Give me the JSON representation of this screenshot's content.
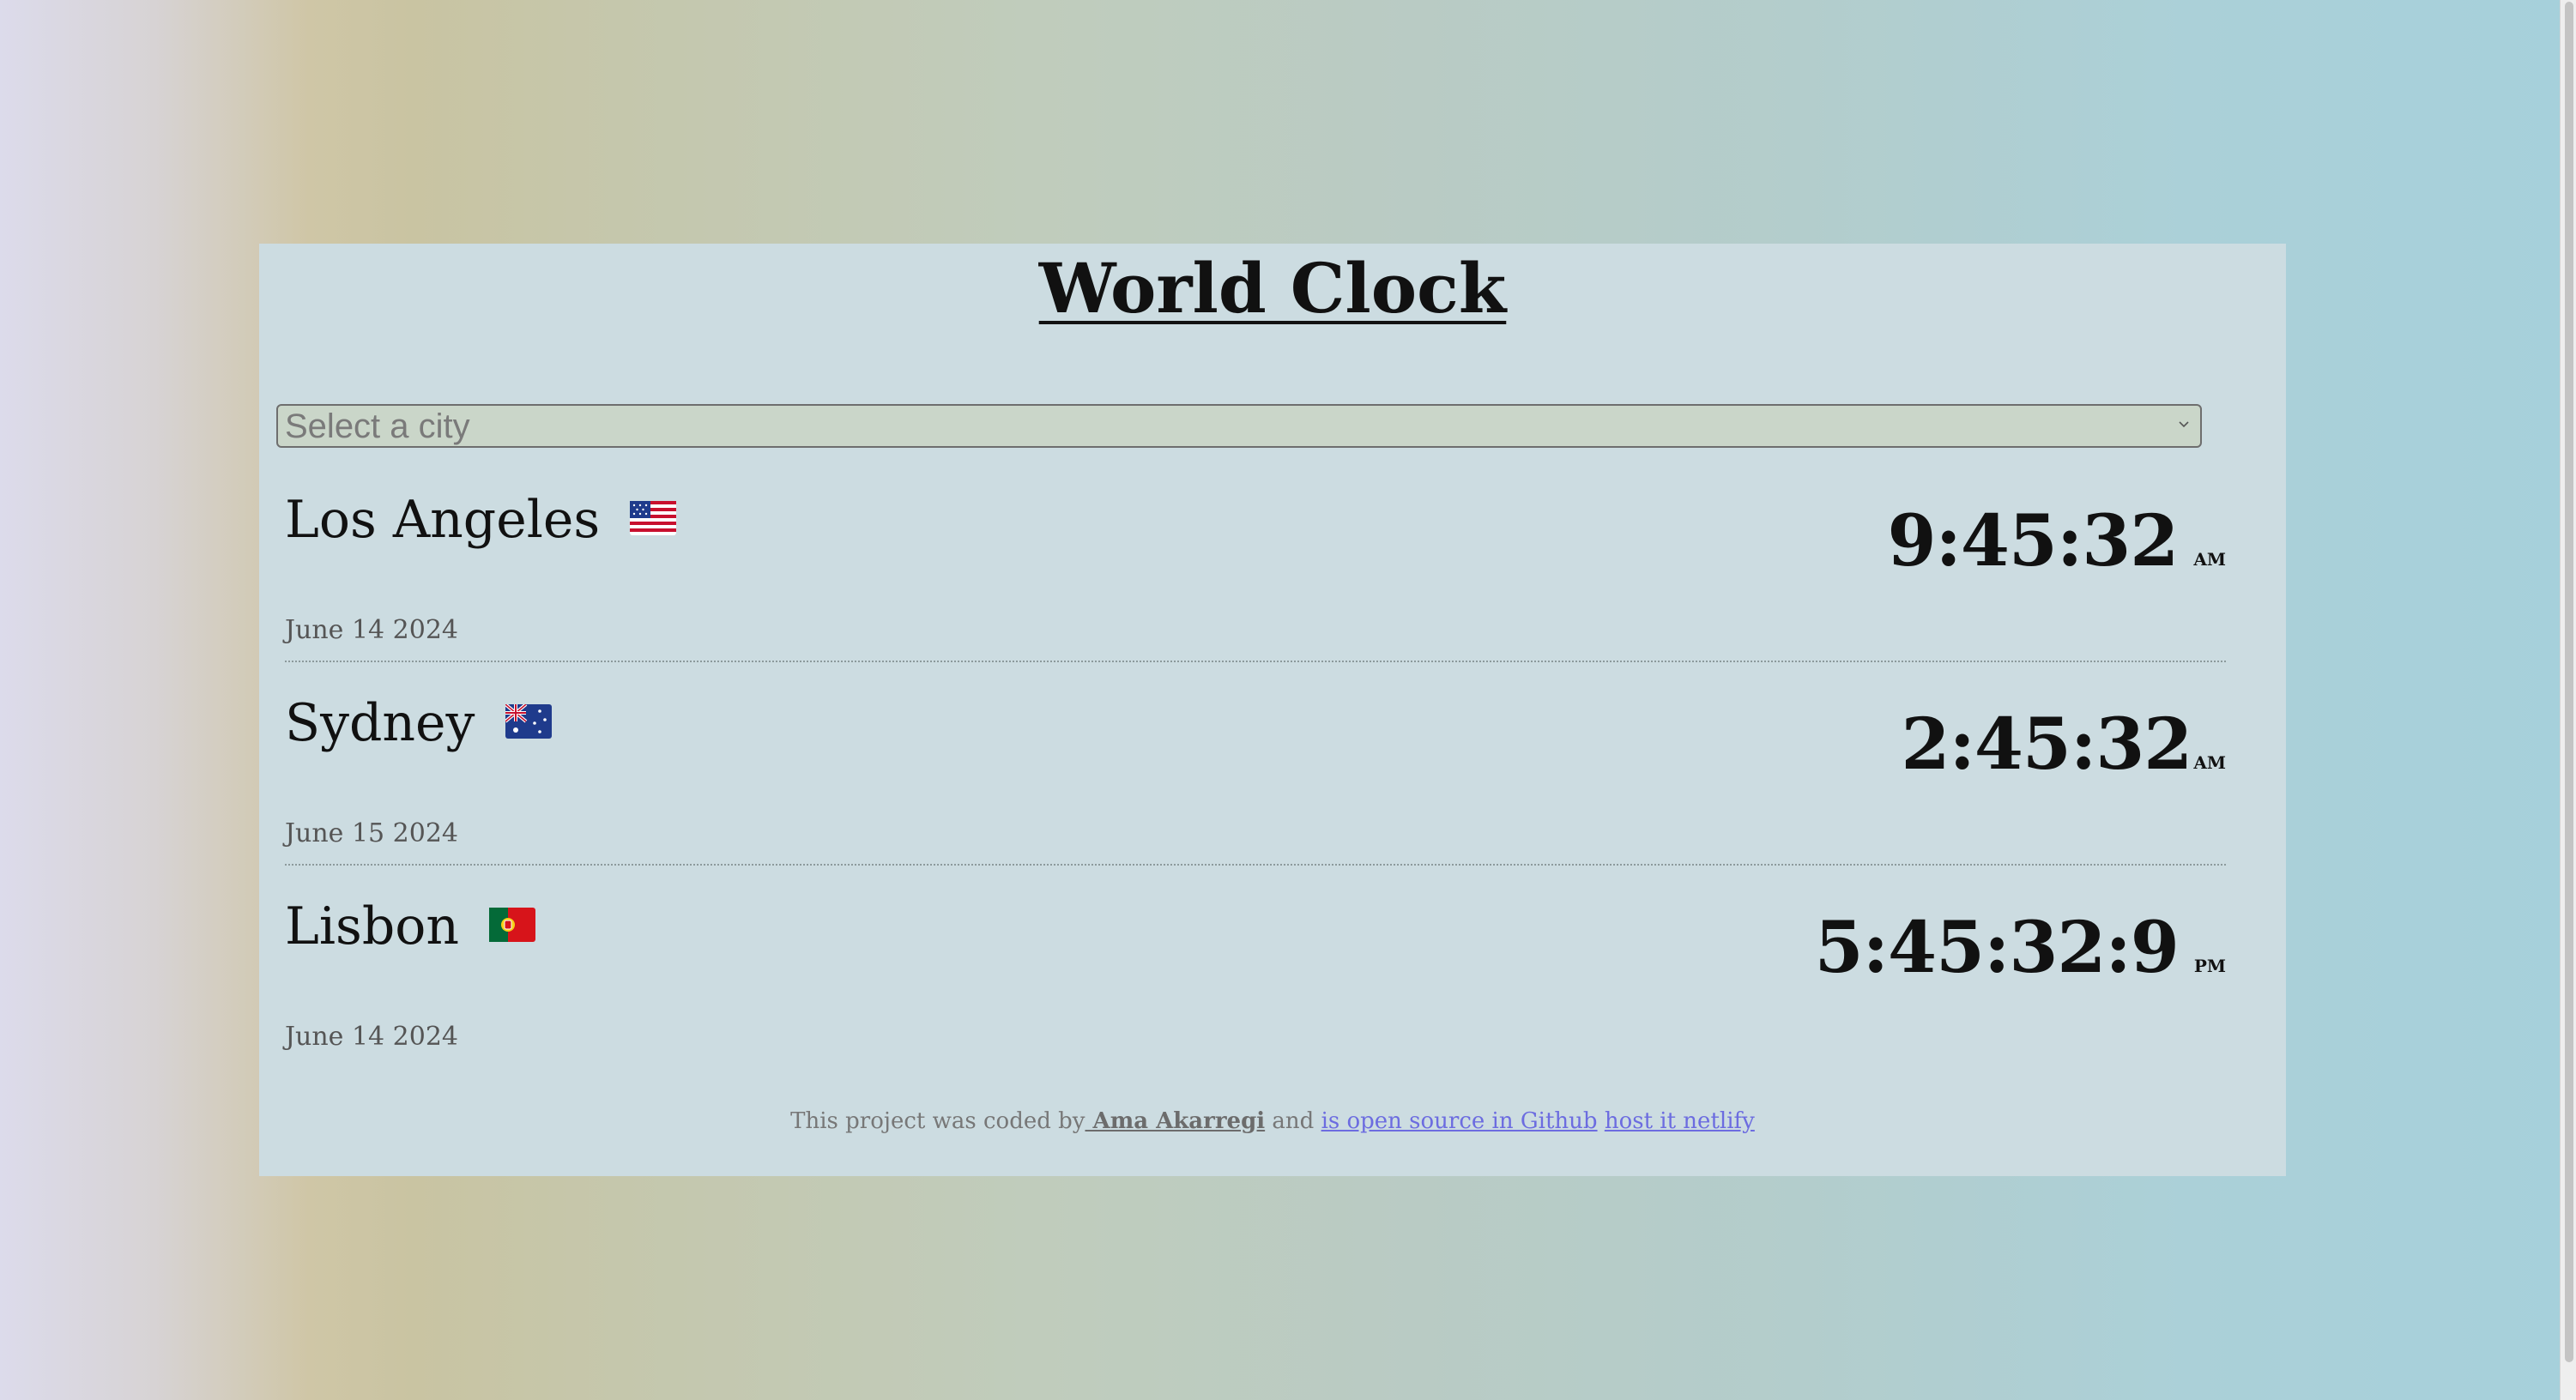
{
  "app": {
    "title": "World Clock"
  },
  "city_select": {
    "placeholder": "Select a city"
  },
  "cities": [
    {
      "name": "Los Angeles",
      "flag": "us-flag-icon",
      "date": "June 14 2024",
      "time": "9:45:32",
      "ampm": "AM"
    },
    {
      "name": "Sydney",
      "flag": "au-flag-icon",
      "date": "June 15 2024",
      "time": "2:45:32",
      "ampm": "AM"
    },
    {
      "name": "Lisbon",
      "flag": "pt-flag-icon",
      "date": "June 14 2024",
      "time": "5:45:32:9",
      "ampm": "PM"
    }
  ],
  "footer": {
    "prefix": "This project was coded by",
    "author": " Ama Akarregi",
    "and": " and ",
    "github_link": "is open source in Github",
    "netlify_link": "host it netlify"
  },
  "colors": {
    "card_background": "#ccdce1",
    "link": "#6c6ce0",
    "text": "#111111"
  }
}
